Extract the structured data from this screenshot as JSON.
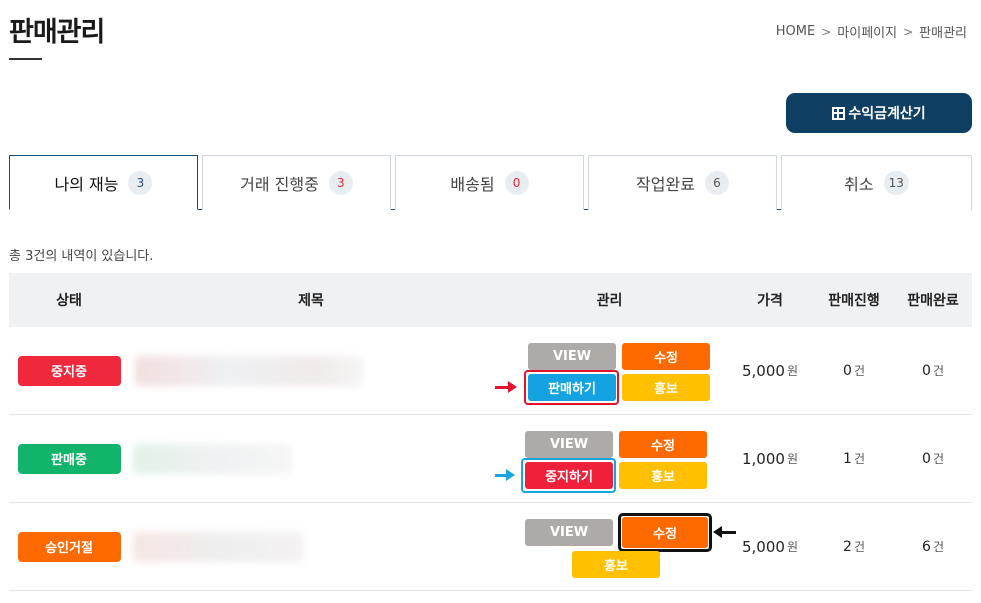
{
  "page": {
    "title": "판매관리",
    "breadcrumb": [
      "HOME",
      "마이페이지",
      "판매관리"
    ],
    "breadcrumb_separator": ">"
  },
  "calculator_button": {
    "label": "수익금계산기",
    "icon": "grid-table-icon",
    "color": "#0f3f63"
  },
  "tabs": [
    {
      "label": "나의 재능",
      "count": "3",
      "active": true
    },
    {
      "label": "거래 진행중",
      "count": "3",
      "active": false
    },
    {
      "label": "배송됨",
      "count": "0",
      "active": false
    },
    {
      "label": "작업완료",
      "count": "6",
      "active": false
    },
    {
      "label": "취소",
      "count": "13",
      "active": false
    }
  ],
  "summary": "총 3건의 내역이 있습니다.",
  "table": {
    "headers": [
      "상태",
      "제목",
      "관리",
      "가격",
      "판매진행",
      "판매완료"
    ],
    "rows": [
      {
        "status": "중지중",
        "status_color": "#f0283c",
        "buttons": {
          "view": "VIEW",
          "edit": "수정",
          "toggle": "판매하기",
          "promo": "홍보"
        },
        "price": "5,000",
        "price_unit": "원",
        "in_progress": "0",
        "completed": "0",
        "count_unit": "건"
      },
      {
        "status": "판매중",
        "status_color": "#12b36b",
        "buttons": {
          "view": "VIEW",
          "edit": "수정",
          "toggle": "중지하기",
          "promo": "홍보"
        },
        "price": "1,000",
        "price_unit": "원",
        "in_progress": "1",
        "completed": "0",
        "count_unit": "건"
      },
      {
        "status": "승인거절",
        "status_color": "#ff6a00",
        "buttons": {
          "view": "VIEW",
          "edit": "수정",
          "promo": "홍보"
        },
        "price": "5,000",
        "price_unit": "원",
        "in_progress": "2",
        "completed": "6",
        "count_unit": "건"
      }
    ]
  },
  "colors": {
    "accent_navy": "#0f3f63",
    "edit_orange": "#ff6a00",
    "promo_yellow": "#ffc000",
    "view_gray": "#aeaaa8",
    "sell_blue": "#14a3e0",
    "stop_red": "#f0203a",
    "annotation_red": "#e2142d",
    "annotation_blue": "#1aa3e0",
    "annotation_black": "#111111"
  }
}
